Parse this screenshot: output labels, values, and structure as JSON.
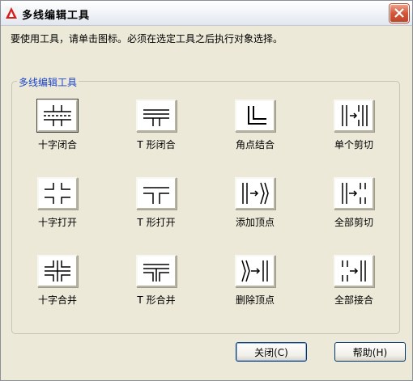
{
  "window": {
    "title": "多线编辑工具"
  },
  "instruction": "要使用工具，请单击图标。必须在选定工具之后执行对象选择。",
  "group": {
    "label": "多线编辑工具",
    "tools": [
      {
        "label": "十字闭合",
        "icon": "cross-closed-icon"
      },
      {
        "label": "T 形闭合",
        "icon": "tee-closed-icon"
      },
      {
        "label": "角点结合",
        "icon": "corner-joint-icon"
      },
      {
        "label": "单个剪切",
        "icon": "cut-single-icon"
      },
      {
        "label": "十字打开",
        "icon": "cross-open-icon"
      },
      {
        "label": "T 形打开",
        "icon": "tee-open-icon"
      },
      {
        "label": "添加顶点",
        "icon": "add-vertex-icon"
      },
      {
        "label": "全部剪切",
        "icon": "cut-all-icon"
      },
      {
        "label": "十字合并",
        "icon": "cross-merged-icon"
      },
      {
        "label": "T 形合并",
        "icon": "tee-merged-icon"
      },
      {
        "label": "删除顶点",
        "icon": "delete-vertex-icon"
      },
      {
        "label": "全部接合",
        "icon": "weld-all-icon"
      }
    ]
  },
  "buttons": {
    "close": "关闭(C)",
    "help": "帮助(H)"
  }
}
